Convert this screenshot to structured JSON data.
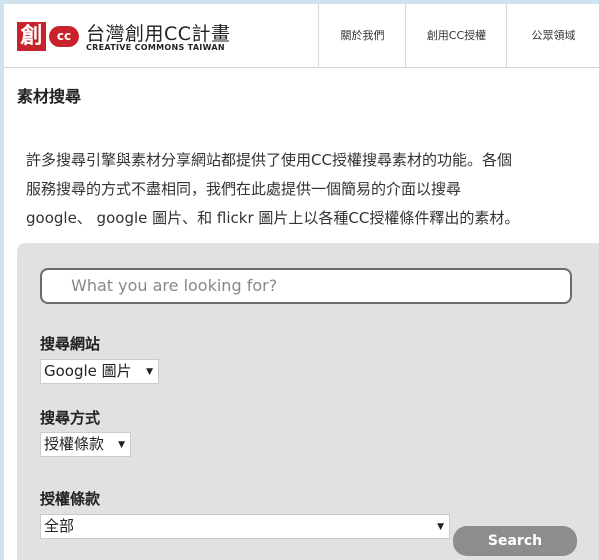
{
  "header": {
    "logo_char": "創",
    "logo_cc": "cc",
    "title": "台灣創用CC計畫",
    "subtitle": "CREATIVE COMMONS TAIWAN",
    "nav": [
      "關於我們",
      "創用CC授權",
      "公眾領域"
    ]
  },
  "main": {
    "section_title": "素材搜尋",
    "intro_lines": [
      "許多搜尋引擎與素材分享網站都提供了使用CC授權搜尋素材的功能。各個",
      "服務搜尋的方式不盡相同，我們在此處提供一個簡易的介面以搜尋",
      "google、 google 圖片、和 flickr 圖片上以各種CC授權條件釋出的素材。"
    ]
  },
  "search": {
    "placeholder": "What you are looking for?",
    "site_label": "搜尋網站",
    "site_value": "Google 圖片",
    "method_label": "搜尋方式",
    "method_value": "授權條款",
    "license_label": "授權條款",
    "license_value": "全部",
    "button_label": "Search",
    "dropdown_arrow": "▼"
  }
}
